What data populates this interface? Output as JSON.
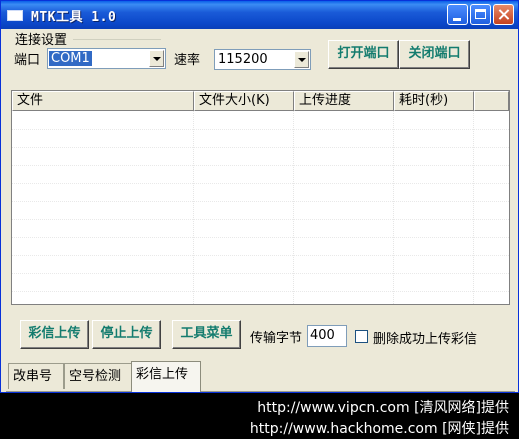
{
  "window": {
    "title": "MTK工具 1.0"
  },
  "connection": {
    "group_label": "连接设置",
    "port_label": "端口",
    "port_value": "COM1",
    "rate_label": "速率",
    "rate_value": "115200",
    "open_button": "打开端口",
    "close_button": "关闭端口"
  },
  "file_list": {
    "columns": [
      "文件",
      "文件大小(K)",
      "上传进度",
      "耗时(秒)"
    ],
    "rows": []
  },
  "actions": {
    "upload_button": "彩信上传",
    "stop_button": "停止上传",
    "tools_button": "工具菜单",
    "bytes_label": "传输字节",
    "bytes_value": "400",
    "delete_checkbox_label": "删除成功上传彩信",
    "delete_checked": false
  },
  "tabs": [
    {
      "label": "改串号",
      "active": false
    },
    {
      "label": "空号检测",
      "active": false
    },
    {
      "label": "彩信上传",
      "active": true
    }
  ],
  "watermark": {
    "line1": "http://www.vipcn.com [清风网络]提供",
    "line2": "http://www.hackhome.com [网侠]提供"
  },
  "colors": {
    "button_text": "#137c6e",
    "title_bar": "#0b47c9",
    "selection": "#316ac5"
  }
}
